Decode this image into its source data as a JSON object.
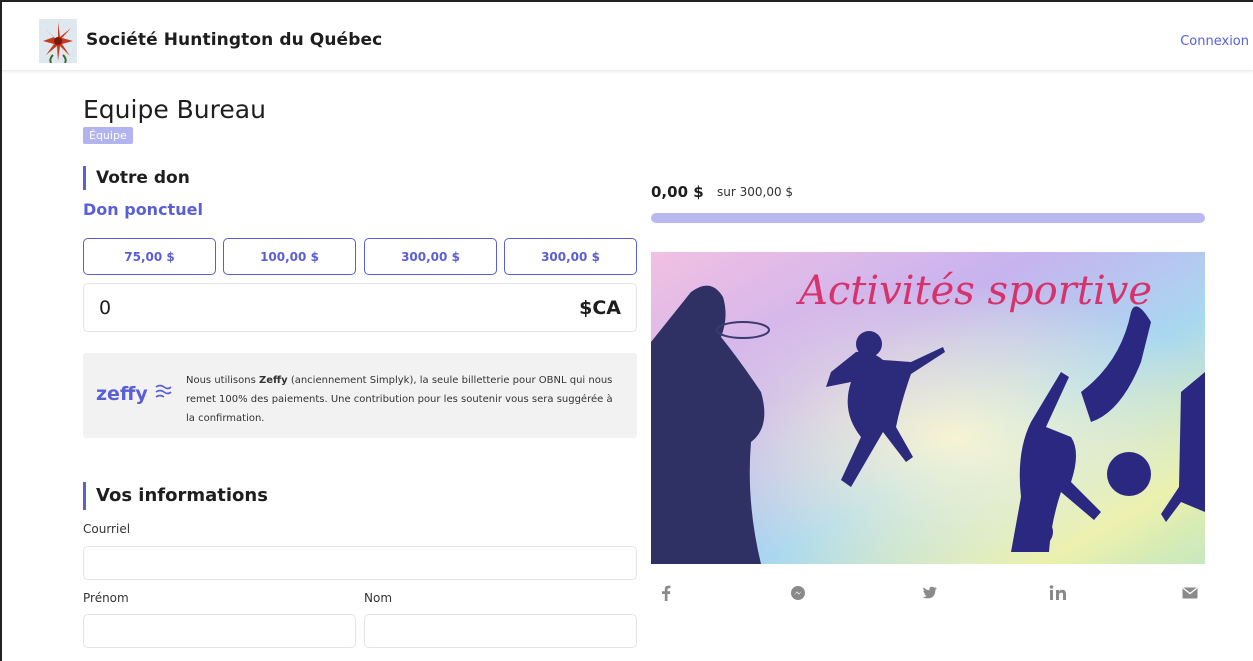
{
  "header": {
    "org_name": "Société Huntington du Québec",
    "login_label": "Connexion"
  },
  "page": {
    "title": "Equipe Bureau",
    "badge": "Équipe"
  },
  "donation": {
    "section_title": "Votre don",
    "type_label": "Don ponctuel",
    "amount_options": [
      "75,00 $",
      "100,00 $",
      "300,00 $",
      "300,00 $"
    ],
    "amount_value": "0",
    "currency": "$CA"
  },
  "zeffy": {
    "logo_text": "zeffy",
    "icon": "wave-icon",
    "text_before": "Nous utilisons ",
    "text_bold": "Zeffy",
    "text_after": " (anciennement Simplyk), la seule billetterie pour OBNL qui nous remet 100% des paiements. Une contribution pour les soutenir vous sera suggérée à la confirmation."
  },
  "info": {
    "section_title": "Vos informations",
    "email_label": "Courriel",
    "email_value": "",
    "first_name_label": "Prénom",
    "first_name_value": "",
    "last_name_label": "Nom",
    "last_name_value": ""
  },
  "progress": {
    "raised": "0,00 $",
    "goal_text": "sur  300,00 $",
    "fraction": 0
  },
  "banner": {
    "text": "Activités sportive"
  },
  "share": [
    {
      "name": "facebook-icon",
      "glyph": "f"
    },
    {
      "name": "messenger-icon",
      "glyph": "◉"
    },
    {
      "name": "twitter-icon",
      "glyph": "🐦"
    },
    {
      "name": "linkedin-icon",
      "glyph": "in"
    },
    {
      "name": "mail-icon",
      "glyph": "✉"
    }
  ],
  "colors": {
    "accent": "#5a5fd6",
    "accent_light": "#b9b9ef",
    "badge": "#b3b3ef"
  }
}
